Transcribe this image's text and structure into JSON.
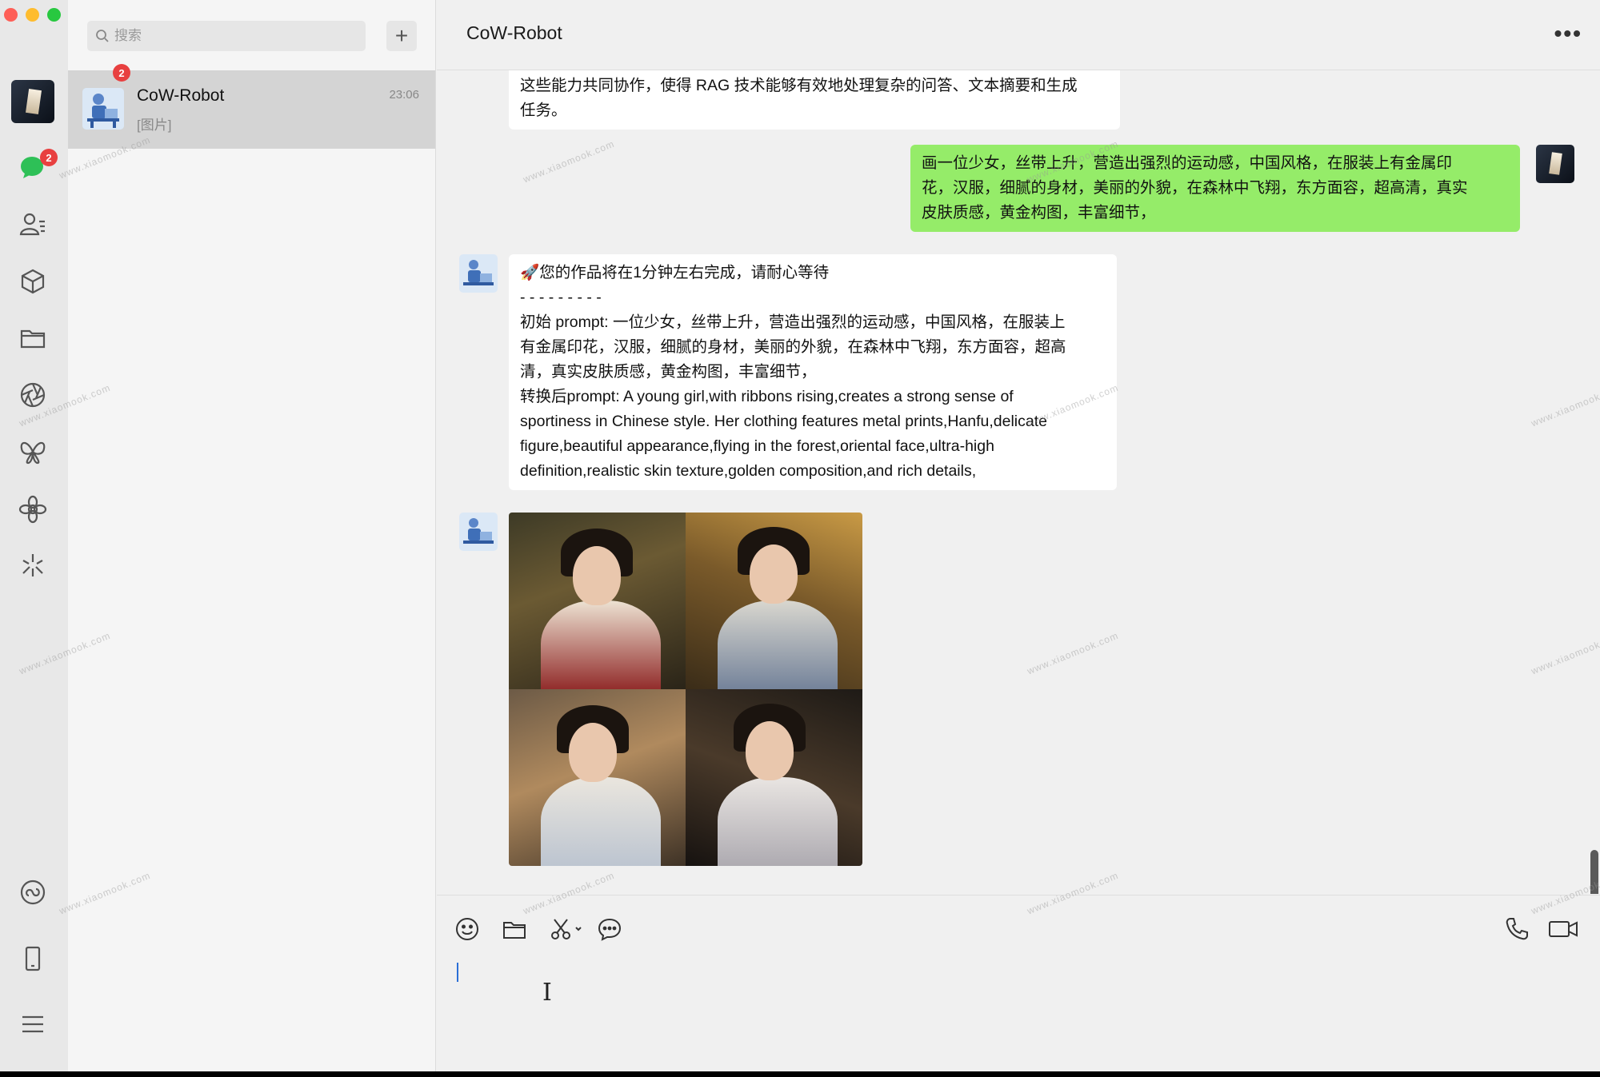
{
  "window": {
    "traffic_lights": [
      "close",
      "minimize",
      "maximize"
    ]
  },
  "rail": {
    "chat_badge": "2",
    "icons": [
      "chat-icon",
      "contacts-icon",
      "cube-icon",
      "folder-icon",
      "aperture-icon",
      "butterfly-icon",
      "flower-icon",
      "sparkle-icon",
      "miniprogram-icon",
      "phone-icon",
      "menu-icon"
    ]
  },
  "search": {
    "placeholder": "搜索",
    "add_label": "+"
  },
  "conversations": [
    {
      "name": "CoW-Robot",
      "time": "23:06",
      "preview": "[图片]",
      "badge": "2"
    }
  ],
  "chat": {
    "title": "CoW-Robot",
    "more_label": "•••",
    "messages": {
      "m1": {
        "sender": "bot",
        "lines": [
          "这些能力共同协作，使得 RAG 技术能够有效地处理复杂的问答、文本摘要和生成",
          "任务。"
        ]
      },
      "m2": {
        "sender": "me",
        "lines": [
          "画一位少女，丝带上升，营造出强烈的运动感，中国风格，在服装上有金属印",
          "花，汉服，细腻的身材，美丽的外貌，在森林中飞翔，东方面容，超高清，真实",
          "皮肤质感，黄金构图，丰富细节，"
        ]
      },
      "m3": {
        "sender": "bot",
        "lines": [
          "🚀您的作品将在1分钟左右完成，请耐心等待",
          "- - - - - - - - -",
          "初始 prompt: 一位少女，丝带上升，营造出强烈的运动感，中国风格，在服装上",
          "有金属印花，汉服，细腻的身材，美丽的外貌，在森林中飞翔，东方面容，超高",
          "清，真实皮肤质感，黄金构图，丰富细节，",
          "转换后prompt: A young girl,with ribbons rising,creates a strong sense of",
          "sportiness in Chinese style. Her clothing features metal prints,Hanfu,delicate",
          "figure,beautiful appearance,flying in the forest,oriental face,ultra-high",
          "definition,realistic skin texture,golden composition,and rich details,"
        ]
      },
      "m4": {
        "sender": "bot",
        "type": "image",
        "content": "2x2 grid of generated images of a girl in Hanfu with flowing ribbons in a forest"
      }
    }
  },
  "composer": {
    "tools": [
      "emoji-icon",
      "file-icon",
      "screenshot-icon",
      "chat-history-icon"
    ],
    "right_tools": [
      "voice-call-icon",
      "video-call-icon"
    ]
  },
  "watermark": "www.xiaomook.com",
  "colors": {
    "my_bubble": "#95ec69",
    "badge": "#e84040",
    "selected_conv": "#d4d4d4"
  }
}
